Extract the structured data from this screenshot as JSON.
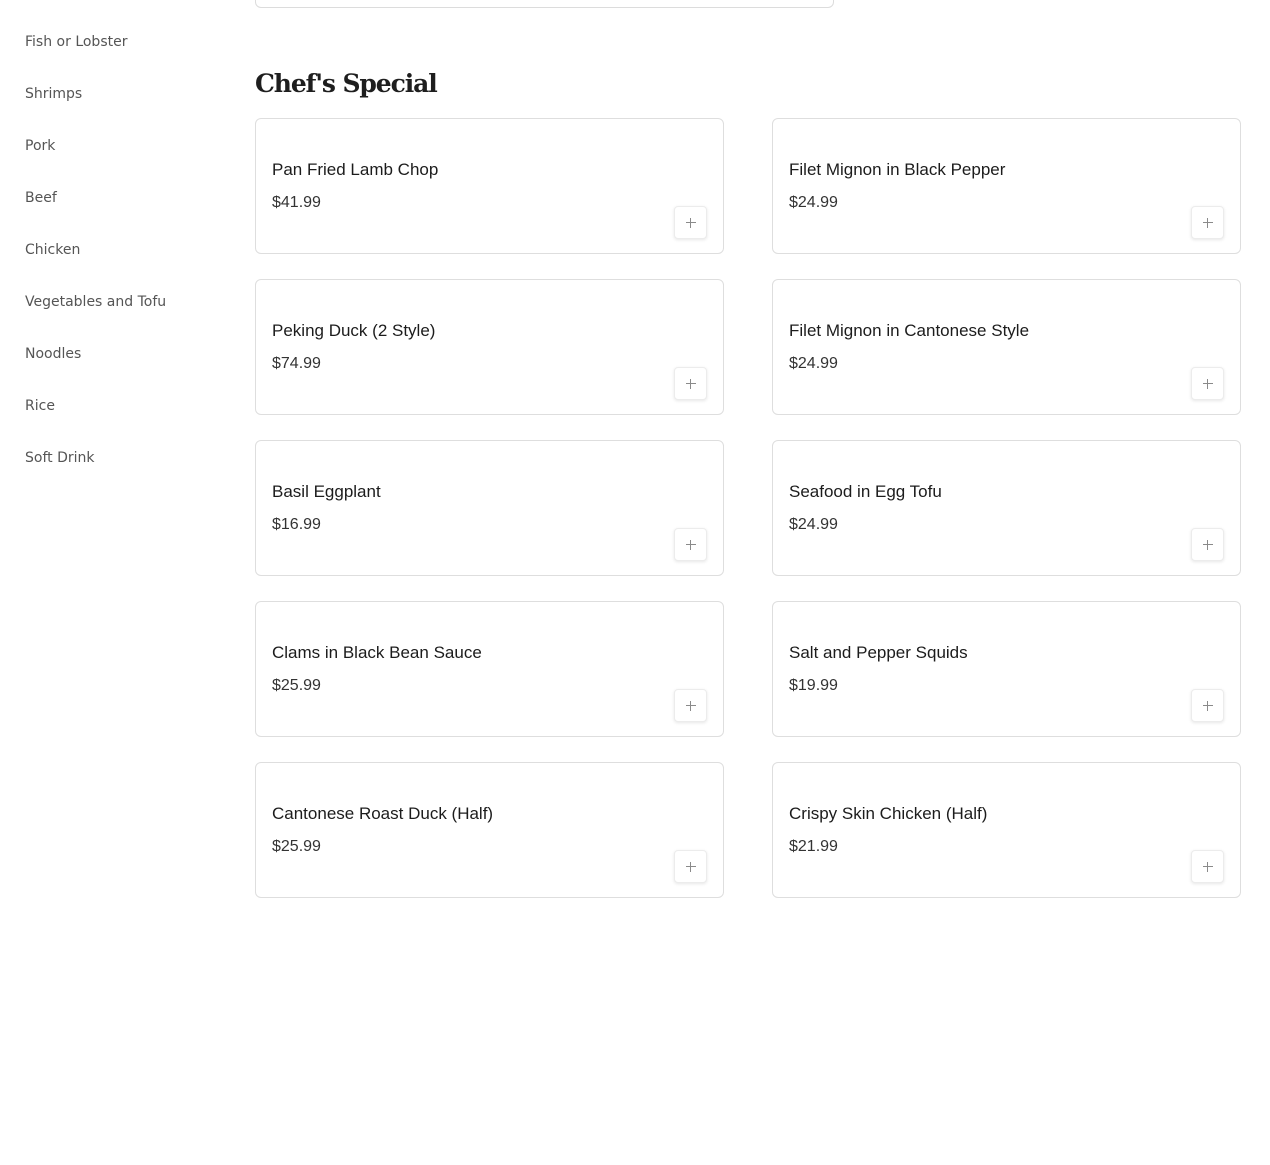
{
  "sidebar": {
    "items": [
      {
        "label": "Fish or Lobster"
      },
      {
        "label": "Shrimps"
      },
      {
        "label": "Pork"
      },
      {
        "label": "Beef"
      },
      {
        "label": "Chicken"
      },
      {
        "label": "Vegetables and Tofu"
      },
      {
        "label": "Noodles"
      },
      {
        "label": "Rice"
      },
      {
        "label": "Soft Drink"
      }
    ]
  },
  "section": {
    "title": "Chef's Special",
    "items": [
      {
        "name": "Pan Fried Lamb Chop",
        "price": "$41.99"
      },
      {
        "name": "Filet Mignon in Black Pepper",
        "price": "$24.99"
      },
      {
        "name": "Peking Duck (2 Style)",
        "price": "$74.99"
      },
      {
        "name": "Filet Mignon in Cantonese Style",
        "price": "$24.99"
      },
      {
        "name": "Basil Eggplant",
        "price": "$16.99"
      },
      {
        "name": "Seafood in Egg Tofu",
        "price": "$24.99"
      },
      {
        "name": "Clams in Black Bean Sauce",
        "price": "$25.99"
      },
      {
        "name": "Salt and Pepper Squids",
        "price": "$19.99"
      },
      {
        "name": "Cantonese Roast Duck (Half)",
        "price": "$25.99"
      },
      {
        "name": "Crispy Skin Chicken (Half)",
        "price": "$21.99"
      }
    ],
    "add_icon": "plus-icon"
  },
  "colors": {
    "card_border": "#dedede",
    "sidebar_text": "#555555",
    "title_text": "#1e1e1e"
  }
}
